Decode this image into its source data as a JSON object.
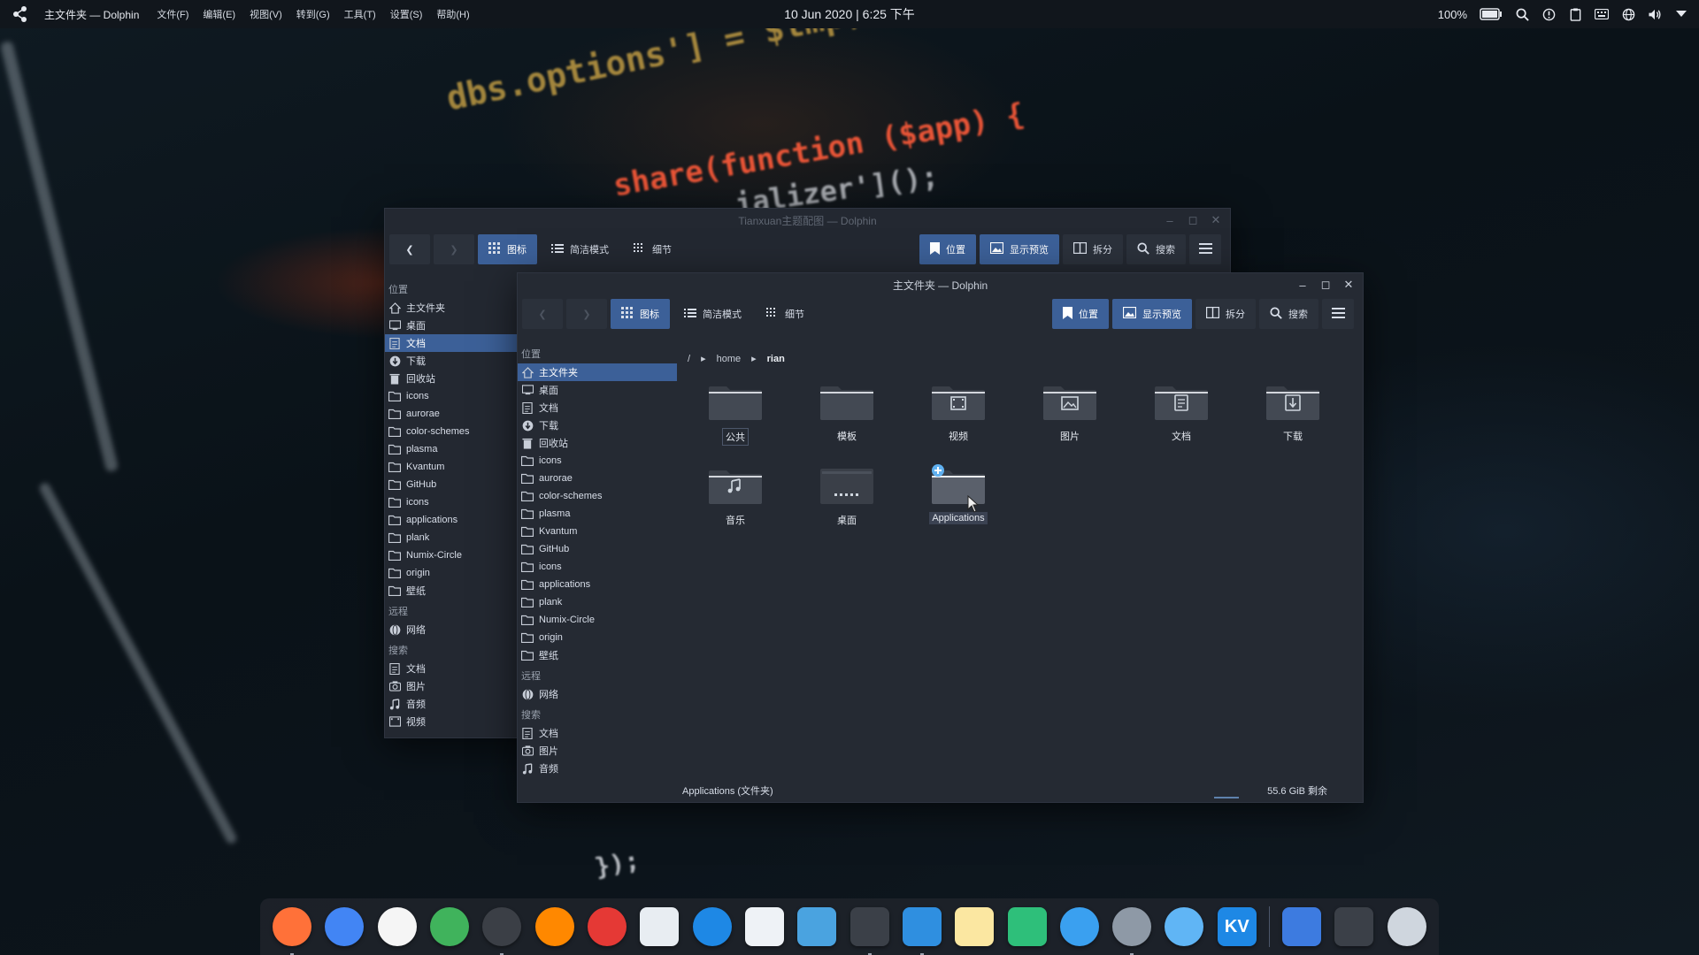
{
  "top_panel": {
    "app_title": "主文件夹 — Dolphin",
    "menus": [
      "文件(F)",
      "编辑(E)",
      "视图(V)",
      "转到(G)",
      "工具(T)",
      "设置(S)",
      "帮助(H)"
    ],
    "clock": "10 Jun 2020 | 6:25 下午",
    "battery": "100%"
  },
  "wallpaper": {
    "line1": "dbs.options'] = $tmp;",
    "line2": "share(function ($app) {",
    "line3": "ializer'](); ",
    "line4": "});"
  },
  "toolbar": {
    "icons_view": "图标",
    "compact_view": "简洁模式",
    "details_view": "细节",
    "places": "位置",
    "show_preview": "显示预览",
    "split": "拆分",
    "search": "搜索"
  },
  "back_window": {
    "title": "Tianxuan主题配图 — Dolphin",
    "sidebar": {
      "places_header": "位置",
      "places": [
        {
          "label": "主文件夹",
          "icon": "home"
        },
        {
          "label": "桌面",
          "icon": "desktop"
        },
        {
          "label": "文档",
          "icon": "document",
          "selected": true
        },
        {
          "label": "下载",
          "icon": "download"
        },
        {
          "label": "回收站",
          "icon": "trash"
        },
        {
          "label": "icons",
          "icon": "folder"
        },
        {
          "label": "aurorae",
          "icon": "folder"
        },
        {
          "label": "color-schemes",
          "icon": "folder"
        },
        {
          "label": "plasma",
          "icon": "folder"
        },
        {
          "label": "Kvantum",
          "icon": "folder"
        },
        {
          "label": "GitHub",
          "icon": "folder"
        },
        {
          "label": "icons",
          "icon": "folder"
        },
        {
          "label": "applications",
          "icon": "folder"
        },
        {
          "label": "plank",
          "icon": "folder"
        },
        {
          "label": "Numix-Circle",
          "icon": "folder"
        },
        {
          "label": "origin",
          "icon": "folder"
        },
        {
          "label": "壁纸",
          "icon": "folder"
        }
      ],
      "remote_header": "远程",
      "remote": [
        {
          "label": "网络",
          "icon": "network"
        }
      ],
      "search_header": "搜索",
      "search": [
        {
          "label": "文档",
          "icon": "document"
        },
        {
          "label": "图片",
          "icon": "camera"
        },
        {
          "label": "音频",
          "icon": "music"
        },
        {
          "label": "视频",
          "icon": "video"
        }
      ]
    }
  },
  "front_window": {
    "title": "主文件夹 — Dolphin",
    "breadcrumb": [
      "/",
      "home",
      "rian"
    ],
    "sidebar": {
      "places_header": "位置",
      "places": [
        {
          "label": "主文件夹",
          "icon": "home",
          "selected": true
        },
        {
          "label": "桌面",
          "icon": "desktop"
        },
        {
          "label": "文档",
          "icon": "document"
        },
        {
          "label": "下载",
          "icon": "download"
        },
        {
          "label": "回收站",
          "icon": "trash"
        },
        {
          "label": "icons",
          "icon": "folder"
        },
        {
          "label": "aurorae",
          "icon": "folder"
        },
        {
          "label": "color-schemes",
          "icon": "folder"
        },
        {
          "label": "plasma",
          "icon": "folder"
        },
        {
          "label": "Kvantum",
          "icon": "folder"
        },
        {
          "label": "GitHub",
          "icon": "folder"
        },
        {
          "label": "icons",
          "icon": "folder"
        },
        {
          "label": "applications",
          "icon": "folder"
        },
        {
          "label": "plank",
          "icon": "folder"
        },
        {
          "label": "Numix-Circle",
          "icon": "folder"
        },
        {
          "label": "origin",
          "icon": "folder"
        },
        {
          "label": "壁纸",
          "icon": "folder"
        }
      ],
      "remote_header": "远程",
      "remote": [
        {
          "label": "网络",
          "icon": "network"
        }
      ],
      "search_header": "搜索",
      "search": [
        {
          "label": "文档",
          "icon": "document"
        },
        {
          "label": "图片",
          "icon": "camera"
        },
        {
          "label": "音频",
          "icon": "music"
        },
        {
          "label": "视频",
          "icon": "video"
        }
      ]
    },
    "files": [
      {
        "label": "公共",
        "icon": "folder",
        "state": "boxed"
      },
      {
        "label": "模板",
        "icon": "folder"
      },
      {
        "label": "视频",
        "icon": "folder-video"
      },
      {
        "label": "图片",
        "icon": "folder-pictures"
      },
      {
        "label": "文档",
        "icon": "folder-documents"
      },
      {
        "label": "下载",
        "icon": "folder-download"
      },
      {
        "label": "音乐",
        "icon": "folder-music"
      },
      {
        "label": "桌面",
        "icon": "folder-desktop"
      },
      {
        "label": "Applications",
        "icon": "folder-new",
        "state": "hover"
      }
    ],
    "status_text": "Applications (文件夹)",
    "free_space": "55.6 GiB 剩余"
  },
  "dock": {
    "apps": [
      {
        "name": "Firefox",
        "color": "#ff7139",
        "running": true
      },
      {
        "name": "Chrome",
        "color": "#4285f4"
      },
      {
        "name": "GitHub",
        "color": "#f5f5f5"
      },
      {
        "name": "Atom",
        "color": "#40b35c"
      },
      {
        "name": "Inkscape",
        "color": "#3b3f46",
        "running": true
      },
      {
        "name": "VLC",
        "color": "#ff8800"
      },
      {
        "name": "NetEase Music",
        "color": "#e53935"
      },
      {
        "name": "Mail",
        "color": "#e8edf2"
      },
      {
        "name": "QQ",
        "color": "#1e88e5"
      },
      {
        "name": "Tasks",
        "color": "#eef2f6"
      },
      {
        "name": "Preview",
        "color": "#4aa3e0"
      },
      {
        "name": "Terminal",
        "color": "#3b4048",
        "running": true
      },
      {
        "name": "Dolphin",
        "color": "#2f8fe0",
        "running": true
      },
      {
        "name": "Notes",
        "color": "#fbe7a1"
      },
      {
        "name": "Store",
        "color": "#2ebf7a"
      },
      {
        "name": "Share",
        "color": "#3aa0f0"
      },
      {
        "name": "Settings",
        "color": "#8e99a6",
        "running": true
      },
      {
        "name": "Browser",
        "color": "#60b5f5"
      },
      {
        "name": "Kvantum",
        "color": "#1e88e5",
        "label": "KV"
      },
      {
        "name": "Launcher",
        "color": "#3d7be0"
      },
      {
        "name": "Desktop",
        "color": "#3b4048"
      },
      {
        "name": "Trash",
        "color": "#cfd6de"
      }
    ]
  }
}
